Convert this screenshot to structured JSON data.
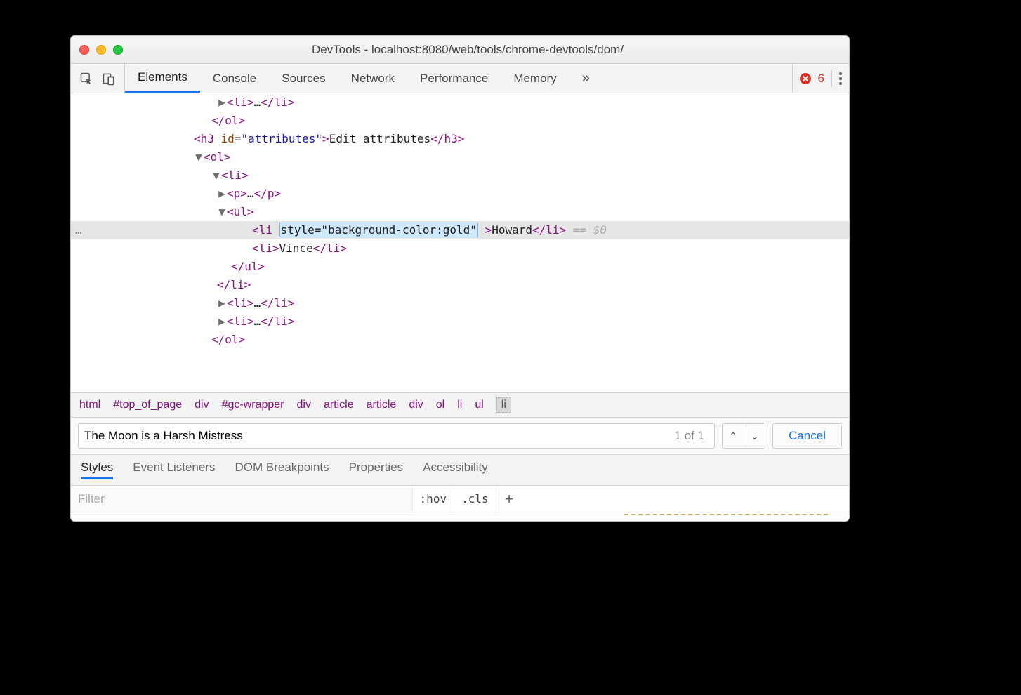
{
  "window": {
    "title": "DevTools - localhost:8080/web/tools/chrome-devtools/dom/"
  },
  "toolbar": {
    "tabs": [
      "Elements",
      "Console",
      "Sources",
      "Network",
      "Performance",
      "Memory"
    ],
    "active_tab": 0,
    "overflow_glyph": "»",
    "error_count": "6"
  },
  "dom": {
    "lines": {
      "l0": "<li>…</li>",
      "l1": "</ol>",
      "h3_tag_open": "<h3 ",
      "h3_attr_name": "id",
      "h3_attr_value": "attributes",
      "h3_text": "Edit attributes",
      "ol_open": "<ol>",
      "li_open": "<li>",
      "p_line": "<p>…</p>",
      "ul_open": "<ul>",
      "li_style_open": "<li",
      "li_style_attr": "style=\"background-color:gold\"",
      "li_style_text": "Howard",
      "li_style_close": "</li>",
      "eq0": "== $0",
      "li_vince": "<li>Vince</li>",
      "ul_close": "</ul>",
      "li_close": "</li>",
      "li_dots": "<li>…</li>",
      "ol_close": "</ol>"
    }
  },
  "breadcrumbs": [
    "html",
    "#top_of_page",
    "div",
    "#gc-wrapper",
    "div",
    "article",
    "article",
    "div",
    "ol",
    "li",
    "ul",
    "li"
  ],
  "search": {
    "value": "The Moon is a Harsh Mistress",
    "count": "1 of 1",
    "cancel": "Cancel"
  },
  "subtabs": {
    "items": [
      "Styles",
      "Event Listeners",
      "DOM Breakpoints",
      "Properties",
      "Accessibility"
    ],
    "active": 0
  },
  "styles": {
    "filter_placeholder": "Filter",
    "hov": ":hov",
    "cls": ".cls",
    "plus": "+"
  }
}
